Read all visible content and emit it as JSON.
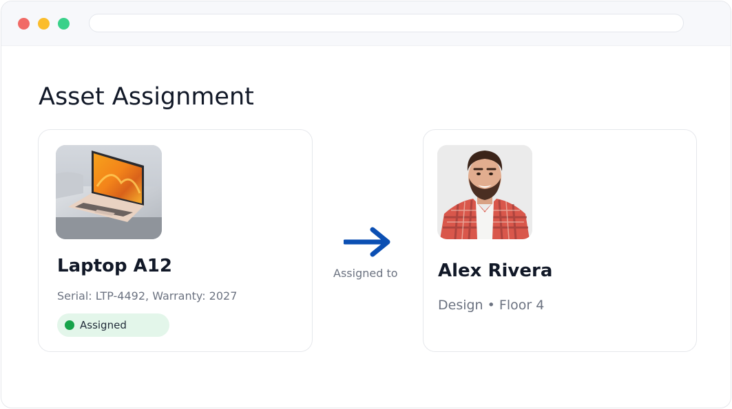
{
  "window": {
    "controls": [
      "close",
      "minimize",
      "maximize"
    ],
    "address_bar": ""
  },
  "page": {
    "title": "Asset Assignment"
  },
  "asset": {
    "name": "Laptop A12",
    "details": "Serial: LTP-4492, Warranty: 2027",
    "status_label": "Assigned",
    "status_color": "#16a34a",
    "image_icon": "laptop-photo"
  },
  "connector": {
    "label": "Assigned to",
    "icon": "arrow-right-icon",
    "color": "#0b4fb3"
  },
  "person": {
    "name": "Alex Rivera",
    "details": "Design • Floor 4",
    "image_icon": "person-photo"
  }
}
